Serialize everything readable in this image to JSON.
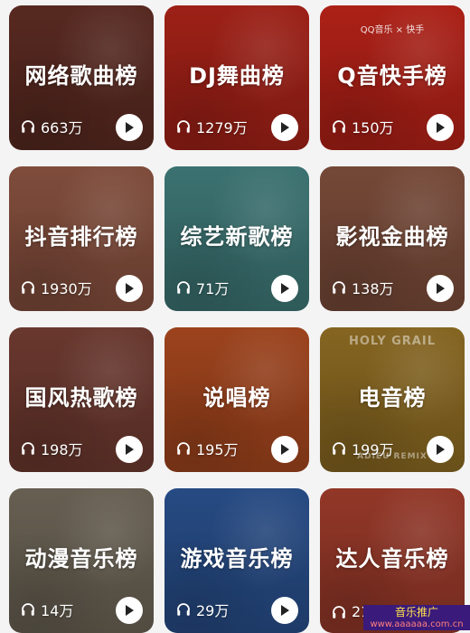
{
  "cards": [
    {
      "title": "网络歌曲榜",
      "plays": "663万",
      "color": "#5b2b22"
    },
    {
      "title": "DJ舞曲榜",
      "plays": "1279万",
      "color": "#a52218"
    },
    {
      "title": "Q音快手榜",
      "plays": "150万",
      "color": "#b52218",
      "logo": "QQ音乐 × 快手"
    },
    {
      "title": "抖音排行榜",
      "plays": "1930万",
      "color": "#86503e"
    },
    {
      "title": "综艺新歌榜",
      "plays": "71万",
      "color": "#3e7877"
    },
    {
      "title": "影视金曲榜",
      "plays": "138万",
      "color": "#7b4c3a"
    },
    {
      "title": "国风热歌榜",
      "plays": "198万",
      "color": "#6e3a30"
    },
    {
      "title": "说唱榜",
      "plays": "195万",
      "color": "#a4461e"
    },
    {
      "title": "电音榜",
      "plays": "199万",
      "color": "#8c6a22",
      "wm_top": "HOLY GRAIL",
      "wm_bottom": "ADIEU REMIX"
    },
    {
      "title": "动漫音乐榜",
      "plays": "14万",
      "color": "#6c6456"
    },
    {
      "title": "游戏音乐榜",
      "plays": "29万",
      "color": "#284e8a"
    },
    {
      "title": "达人音乐榜",
      "plays": "21",
      "color": "#9a3a2a"
    }
  ],
  "promo": {
    "title": "音乐推广",
    "url": "www.aaaaaa.com.cn"
  }
}
